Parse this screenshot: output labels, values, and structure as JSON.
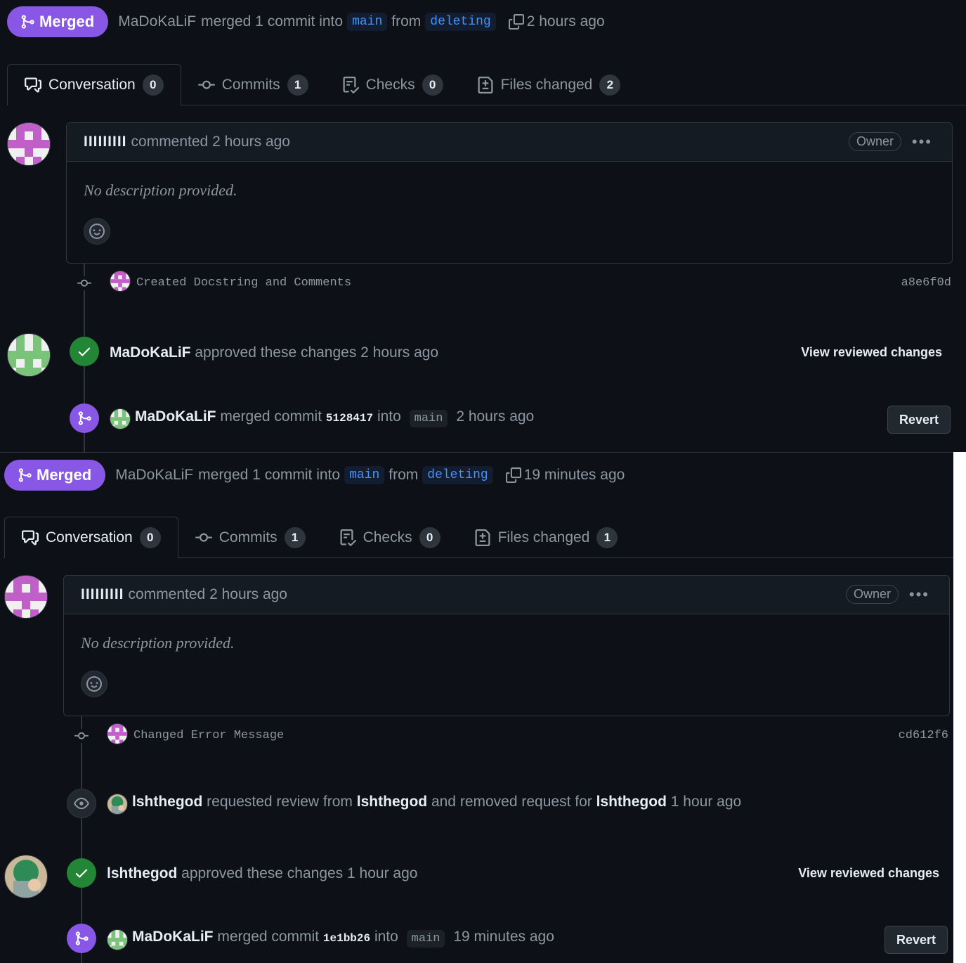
{
  "colors": {
    "merged": "#8957e5",
    "approved": "#238636",
    "bg": "#0d1117",
    "link": "#4493f8"
  },
  "panel1": {
    "badge": "Merged",
    "author": "MaDoKaLiF",
    "summary": "merged 1 commit into",
    "base_branch": "main",
    "from": "from",
    "head_branch": "deleting",
    "time": "2 hours ago",
    "tabs": [
      {
        "label": "Conversation",
        "count": "0",
        "icon": "conversation-icon"
      },
      {
        "label": "Commits",
        "count": "1",
        "icon": "commit-icon"
      },
      {
        "label": "Checks",
        "count": "0",
        "icon": "checks-icon"
      },
      {
        "label": "Files changed",
        "count": "2",
        "icon": "file-diff-icon"
      }
    ],
    "comment": {
      "author": "IIIIIIIII",
      "action": "commented 2 hours ago",
      "badge": "Owner",
      "menu": "•••",
      "body": "No description provided."
    },
    "commit": {
      "message": "Created Docstring and Comments",
      "sha": "a8e6f0d"
    },
    "approval": {
      "user": "MaDoKaLiF",
      "text": "approved these changes 2 hours ago",
      "link": "View reviewed changes"
    },
    "merge": {
      "user": "MaDoKaLiF",
      "pre": "merged commit",
      "sha": "5128417",
      "into": "into",
      "branch": "main",
      "time": "2 hours ago",
      "button": "Revert"
    }
  },
  "panel2": {
    "badge": "Merged",
    "author": "MaDoKaLiF",
    "summary": "merged 1 commit into",
    "base_branch": "main",
    "from": "from",
    "head_branch": "deleting",
    "time": "19 minutes ago",
    "tabs": [
      {
        "label": "Conversation",
        "count": "0",
        "icon": "conversation-icon"
      },
      {
        "label": "Commits",
        "count": "1",
        "icon": "commit-icon"
      },
      {
        "label": "Checks",
        "count": "0",
        "icon": "checks-icon"
      },
      {
        "label": "Files changed",
        "count": "1",
        "icon": "file-diff-icon"
      }
    ],
    "comment": {
      "author": "IIIIIIIII",
      "action": "commented 2 hours ago",
      "badge": "Owner",
      "menu": "•••",
      "body": "No description provided."
    },
    "commit": {
      "message": "Changed Error Message",
      "sha": "cd612f6"
    },
    "review_request": {
      "user": "lshthegod",
      "text1": "requested review from",
      "user2": "lshthegod",
      "text2": "and removed request for",
      "user3": "lshthegod",
      "time": "1 hour ago"
    },
    "approval": {
      "user": "lshthegod",
      "text": "approved these changes 1 hour ago",
      "link": "View reviewed changes"
    },
    "merge": {
      "user": "MaDoKaLiF",
      "pre": "merged commit",
      "sha": "1e1bb26",
      "into": "into",
      "branch": "main",
      "time": "19 minutes ago",
      "button": "Revert"
    }
  }
}
